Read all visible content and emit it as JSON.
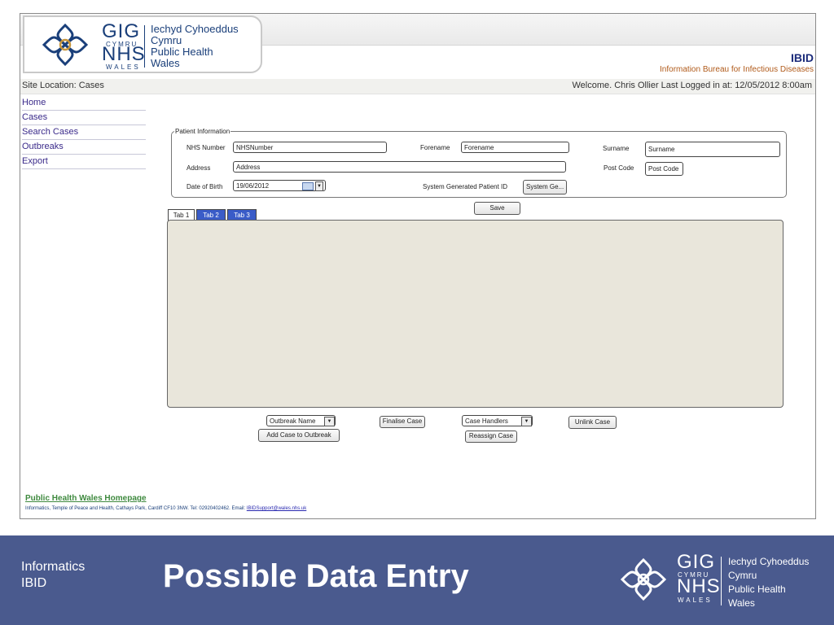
{
  "logo": {
    "gig": "GIG",
    "cymru_small": "CYMRU",
    "nhs": "NHS",
    "wales_small": "WALES",
    "lines": [
      "Iechyd Cyhoeddus",
      "Cymru",
      "Public Health",
      "Wales"
    ]
  },
  "header": {
    "app_name": "IBID",
    "app_subtitle": "Information Bureau for Infectious Diseases",
    "site_location": "Site Location: Cases",
    "welcome": "Welcome. Chris Ollier  Last Logged in at: 12/05/2012 8:00am"
  },
  "sidebar": {
    "items": [
      {
        "label": "Home"
      },
      {
        "label": "Cases"
      },
      {
        "label": "Search Cases"
      },
      {
        "label": "Outbreaks"
      },
      {
        "label": "Export"
      }
    ]
  },
  "patient_info": {
    "legend": "Patient Information",
    "nhs_number": {
      "label": "NHS Number",
      "value": "NHSNumber"
    },
    "forename": {
      "label": "Forename",
      "value": "Forename"
    },
    "surname": {
      "label": "Surname",
      "value": "Surname"
    },
    "address": {
      "label": "Address",
      "value": "Address"
    },
    "post_code": {
      "label": "Post Code",
      "value": "Post Code"
    },
    "dob": {
      "label": "Date of Birth",
      "value": "19/06/2012"
    },
    "patient_id": {
      "label": "System Generated Patient ID",
      "value": "System Ge..."
    }
  },
  "save_label": "Save",
  "tabs": [
    {
      "label": "Tab 1",
      "active": true
    },
    {
      "label": "Tab 2",
      "active": false
    },
    {
      "label": "Tab 3",
      "active": false
    }
  ],
  "actions": {
    "outbreak_select": "Outbreak Name",
    "add_to_outbreak": "Add Case to Outbreak",
    "finalise": "Finalise Case",
    "case_handlers_select": "Case Handlers",
    "reassign": "Reassign Case",
    "unlink": "Unlink Case"
  },
  "footer": {
    "homepage_link": "Public Health Wales Homepage",
    "info": "Informatics, Temple of Peace and Health, Cathays Park, Cardiff CF10 3NW. Tel: 02920402462. Email: ",
    "email": "IBIDSupport@wales.nhs.uk"
  },
  "slide": {
    "left_line1": "Informatics",
    "left_line2": "IBID",
    "title": "Possible Data Entry"
  },
  "colors": {
    "nhs_blue": "#1a3f7a",
    "slide_band": "#4a5a8e",
    "tab_active_bg": "#ffffff",
    "tab_inactive_bg": "#3a5cc8",
    "panel_bg": "#e9e6db"
  }
}
